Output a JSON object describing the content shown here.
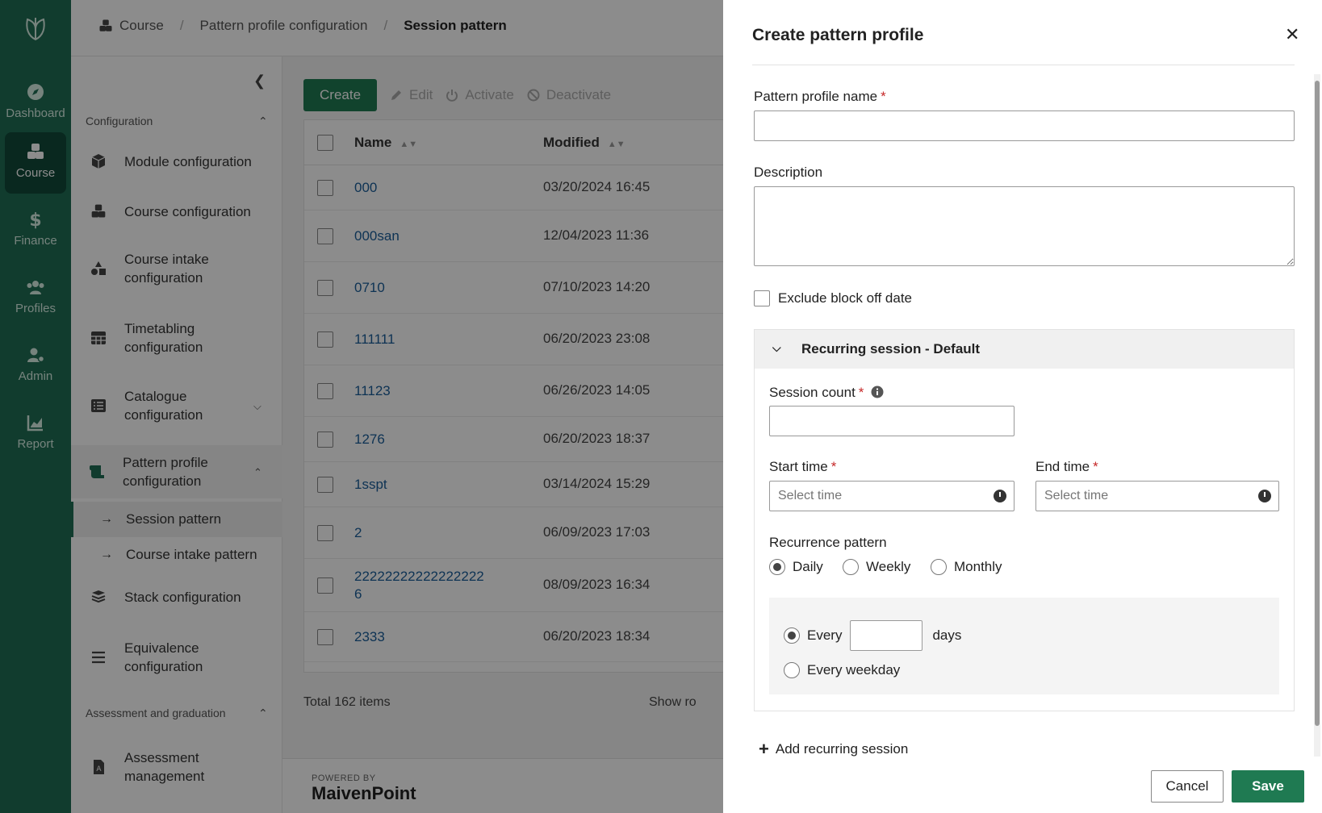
{
  "rail": {
    "logo_icon": "leaf-logo-icon",
    "items": [
      {
        "label": "Dashboard",
        "icon": "compass-icon"
      },
      {
        "label": "Course",
        "icon": "cubes-icon",
        "active": true
      },
      {
        "label": "Finance",
        "icon": "dollar-icon"
      },
      {
        "label": "Profiles",
        "icon": "users-icon"
      },
      {
        "label": "Admin",
        "icon": "user-gear-icon"
      },
      {
        "label": "Report",
        "icon": "chart-icon"
      }
    ]
  },
  "breadcrumb": [
    "Course",
    "Pattern profile configuration",
    "Session pattern"
  ],
  "sidebar": {
    "section_config": "Configuration",
    "items": [
      {
        "label": "Module configuration"
      },
      {
        "label": "Course configuration"
      },
      {
        "label": "Course intake configuration"
      },
      {
        "label": "Timetabling configuration"
      },
      {
        "label": "Catalogue configuration"
      },
      {
        "label": "Pattern profile configuration"
      }
    ],
    "sub_items": [
      "Session pattern",
      "Course intake pattern"
    ],
    "items2": [
      {
        "label": "Stack configuration"
      },
      {
        "label": "Equivalence configuration"
      }
    ],
    "section_assess": "Assessment and graduation",
    "items3": [
      {
        "label": "Assessment management"
      }
    ]
  },
  "toolbar": {
    "create": "Create",
    "edit": "Edit",
    "activate": "Activate",
    "deactivate": "Deactivate"
  },
  "table": {
    "headers": {
      "name": "Name",
      "modified": "Modified"
    },
    "rows": [
      {
        "name": "000",
        "modified": "03/20/2024 16:45"
      },
      {
        "name": "000san",
        "modified": "12/04/2023 11:36"
      },
      {
        "name": "0710",
        "modified": "07/10/2023 14:20"
      },
      {
        "name": "111111",
        "modified": "06/20/2023 23:08"
      },
      {
        "name": "11123",
        "modified": "06/26/2023 14:05"
      },
      {
        "name": "1276",
        "modified": "06/20/2023 18:37"
      },
      {
        "name": "1sspt",
        "modified": "03/14/2024 15:29"
      },
      {
        "name": "2",
        "modified": "06/09/2023 17:03"
      },
      {
        "name": "22222222222222222 6",
        "modified": "08/09/2023 16:34"
      },
      {
        "name": "2333",
        "modified": "06/20/2023 18:34"
      }
    ],
    "total": "Total 162 items",
    "show_rows": "Show ro"
  },
  "footer": {
    "powered": "POWERED BY",
    "brand": "MaivenPoint"
  },
  "drawer": {
    "title": "Create pattern profile",
    "close_icon": "close-icon",
    "name_label": "Pattern profile name",
    "name_value": "",
    "desc_label": "Description",
    "desc_value": "",
    "exclude_label": "Exclude block off date",
    "panel_title": "Recurring session - Default",
    "session_count_label": "Session count",
    "session_count_value": "",
    "start_label": "Start time",
    "end_label": "End time",
    "time_placeholder": "Select time",
    "recurrence_label": "Recurrence pattern",
    "recurrence_options": [
      "Daily",
      "Weekly",
      "Monthly"
    ],
    "recurrence_selected": "Daily",
    "every_label": "Every",
    "every_value": "",
    "days_label": "days",
    "weekday_label": "Every weekday",
    "add_recurring": "Add recurring session",
    "cancel": "Cancel",
    "save": "Save"
  },
  "colors": {
    "brand_green": "#1f6d55",
    "button_green": "#1f7a52",
    "link_blue": "#1b5e9a",
    "required_red": "#c62828"
  }
}
